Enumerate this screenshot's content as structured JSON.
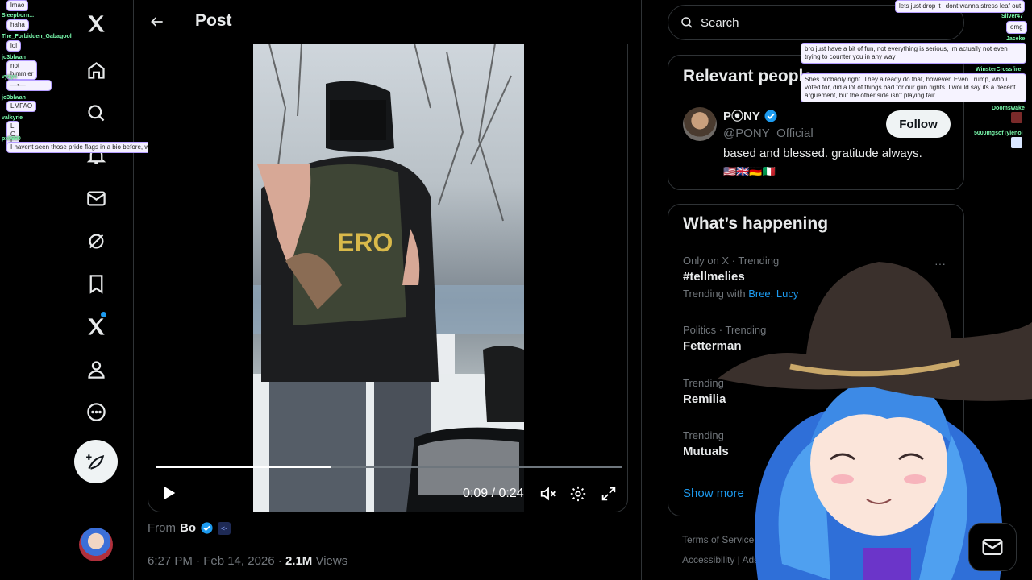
{
  "main": {
    "title": "Post",
    "video": {
      "current_time": "0:09",
      "separator": "/",
      "duration": "0:24",
      "progress": 0.375,
      "vest_text": "ERO"
    },
    "from_label": "From",
    "from_source": "Bo",
    "timestamp": "6:27 PM · Feb 14, 2026",
    "views_count": "2.1M",
    "views_label": "Views"
  },
  "right": {
    "search_placeholder": "Search",
    "relevant_title": "Relevant people",
    "person": {
      "name": "P⦿NY",
      "handle": "@PONY_Official",
      "bio": "based and blessed. gratitude always.",
      "flags": "🇺🇸🇬🇧🇩🇪🇮🇹",
      "follow_label": "Follow"
    },
    "happening_title": "What’s happening",
    "trends": [
      {
        "context": "Only on X · Trending",
        "topic": "#tellmelies",
        "with_label": "Trending with",
        "with_names": "Bree, Lucy"
      },
      {
        "context": "Politics · Trending",
        "topic": "Fetterman"
      },
      {
        "context": "Trending",
        "topic": "Remilia"
      },
      {
        "context": "Trending",
        "topic": "Mutuals"
      }
    ],
    "show_more": "Show more",
    "footer_line1": "Terms of Service  |  Priva",
    "footer_line2": "Accessibility  |  Ads info  |  M"
  },
  "chat_left": [
    {
      "name": "",
      "msg": "lmao"
    },
    {
      "name": "Sleepborn...",
      "msg": "haha"
    },
    {
      "name": "The_Forbidden_Gabagool",
      "msg": "lol"
    },
    {
      "name": "jo3blwan",
      "msg": "not himmler"
    },
    {
      "name": "vyzys",
      "msg": "—•—"
    },
    {
      "name": "jo3blwan",
      "msg": "LMFAO"
    },
    {
      "name": "valkyrie",
      "msg": "L O L"
    },
    {
      "name": "px0990",
      "msg": "I havent seen those pride flags in a bio before, what are they?"
    }
  ],
  "chat_right": [
    {
      "name": "",
      "msg": "lets just drop it i dont wanna stress leaf out"
    },
    {
      "name": "Silver47",
      "msg": "omg"
    },
    {
      "name": "Jaceke",
      "msg": "bro just have a bit of fun, not everything is serious, Im actually not even trying to counter you in any way"
    },
    {
      "name": "WinsterCrossfire",
      "msg": "Shes probably right. They already do that, however. Even Trump, who i voted for, did a lot of things bad for our gun rights. I would say its a decent arguement, but the other side isn't playing fair."
    },
    {
      "name": "Doomswake",
      "msg": ""
    },
    {
      "name": "5000mgsofTylenol",
      "msg": ""
    }
  ],
  "colors": {
    "accent": "#1d9bf0",
    "background": "#000000",
    "border": "#2f3336",
    "muted": "#71767b"
  },
  "icons": [
    "x-logo-icon",
    "home-icon",
    "search-icon",
    "notifications-icon",
    "messages-icon",
    "grok-icon",
    "bookmarks-icon",
    "premium-icon",
    "profile-icon",
    "more-icon"
  ]
}
